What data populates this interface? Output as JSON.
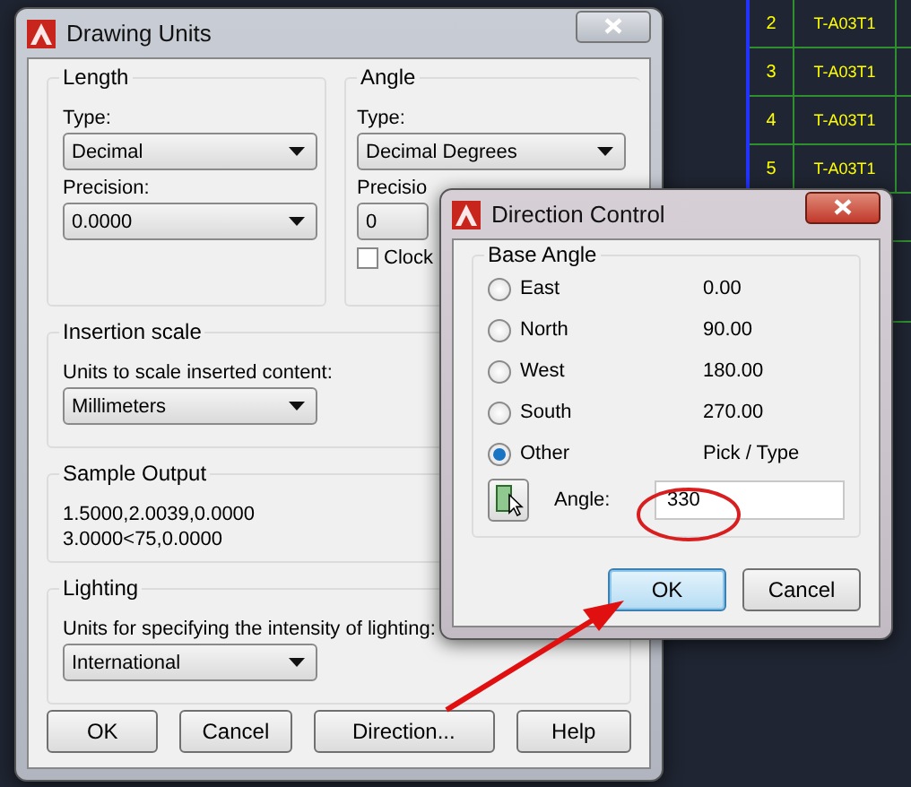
{
  "cad_table": {
    "rows": [
      {
        "number": "2",
        "code": "T-A03T1"
      },
      {
        "number": "3",
        "code": "T-A03T1"
      },
      {
        "number": "4",
        "code": "T-A03T1"
      },
      {
        "number": "5",
        "code": "T-A03T1"
      }
    ]
  },
  "drawing_units": {
    "title": "Drawing Units",
    "length": {
      "label": "Length",
      "type_label": "Type:",
      "type": "Decimal",
      "precision_label": "Precision:",
      "precision": "0.0000"
    },
    "angle": {
      "label": "Angle",
      "type_label": "Type:",
      "type": "Decimal Degrees",
      "precision_label": "Precisio",
      "precision": "0",
      "clockwise": {
        "label": "Clock",
        "checked": false
      }
    },
    "insertion_scale": {
      "label": "Insertion scale",
      "caption": "Units to scale inserted content:",
      "value": "Millimeters"
    },
    "sample_output": {
      "label": "Sample Output",
      "lines": [
        "1.5000,2.0039,0.0000",
        "3.0000<75,0.0000"
      ]
    },
    "lighting": {
      "label": "Lighting",
      "caption": "Units for specifying the intensity of lighting:",
      "value": "International"
    },
    "buttons": [
      "OK",
      "Cancel",
      "Direction...",
      "Help"
    ]
  },
  "direction_control": {
    "title": "Direction Control",
    "group": "Base Angle",
    "options": [
      {
        "label": "East",
        "value": "0.00",
        "selected": false
      },
      {
        "label": "North",
        "value": "90.00",
        "selected": false
      },
      {
        "label": "West",
        "value": "180.00",
        "selected": false
      },
      {
        "label": "South",
        "value": "270.00",
        "selected": false
      },
      {
        "label": "Other",
        "value": "Pick / Type",
        "selected": true
      }
    ],
    "angle_label": "Angle:",
    "angle_value": "330",
    "buttons": [
      {
        "label": "OK",
        "focused": true
      },
      {
        "label": "Cancel",
        "focused": false
      }
    ]
  }
}
